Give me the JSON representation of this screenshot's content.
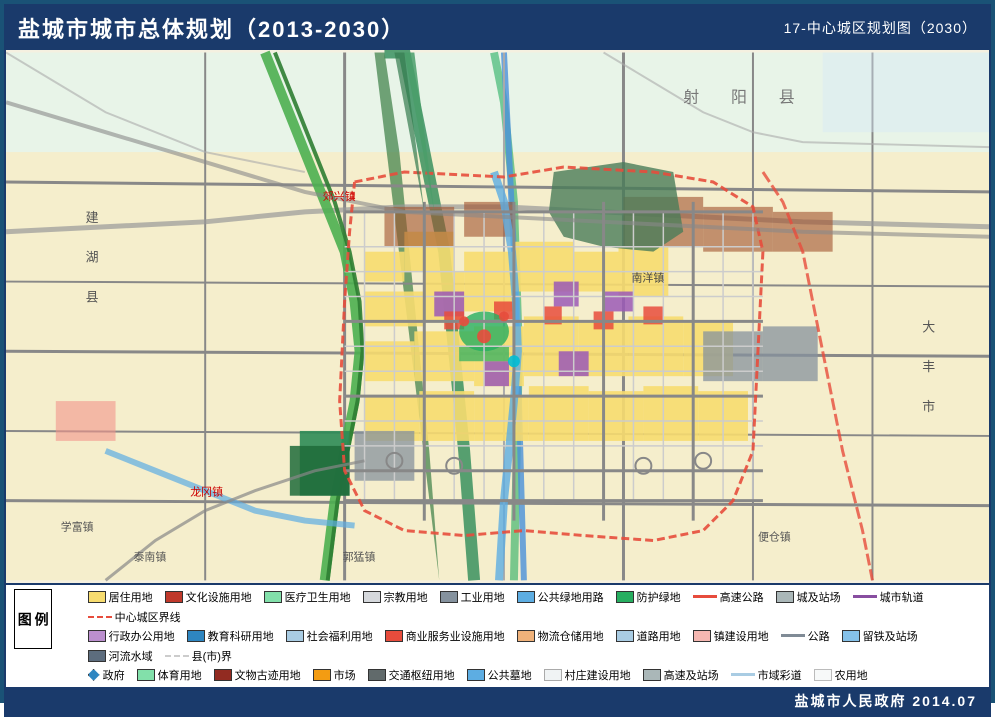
{
  "header": {
    "title": "盐城市城市总体规划（2013-2030）",
    "subtitle": "17-中心城区规划图（2030）"
  },
  "footer": {
    "text": "盐城市人民政府   2014.07"
  },
  "legend": {
    "title": "图\n例",
    "items_row1": [
      {
        "color": "#f7dc6f",
        "label": "居住用地"
      },
      {
        "color": "#d35400",
        "label": "文化设施用地"
      },
      {
        "color": "#82e0aa",
        "label": "医疗卫生用地"
      },
      {
        "color": "#d5d8dc",
        "label": "宗教用地"
      },
      {
        "color": "#808b96",
        "label": "工业用地"
      },
      {
        "color": "#5dade2",
        "label": "公共绿地用路"
      },
      {
        "color": "#27ae60",
        "label": "防护绿地"
      },
      {
        "color": "#e74c3c",
        "label": "高速公路"
      },
      {
        "color": "#aab7b8",
        "label": "城及站场"
      },
      {
        "color": "#884ea0",
        "label": "城市轨道"
      },
      {
        "color": "#e74c3c",
        "label": "中心城区界线",
        "dashed": true
      }
    ],
    "items_row2": [
      {
        "color": "#bb8fce",
        "label": "行政办公用地"
      },
      {
        "color": "#2e86c1",
        "label": "教育科研用地"
      },
      {
        "color": "#a9cce3",
        "label": "社会福利用地"
      },
      {
        "color": "#c0392b",
        "label": "商业服务业设施用地"
      },
      {
        "color": "#f0b27a",
        "label": "物流仓储用地"
      },
      {
        "color": "#a9cce3",
        "label": "道路用地"
      },
      {
        "color": "#f5b7b1",
        "label": "镇建设用地"
      },
      {
        "color": "#808b96",
        "label": "公路"
      },
      {
        "color": "#85c1e9",
        "label": "留铁及站场"
      },
      {
        "color": "#5d6d7e",
        "label": "河流水域"
      },
      {
        "color": "#ecf0f1",
        "label": "县(市)界"
      }
    ],
    "items_row3": [
      {
        "color": "#2e86c1",
        "label": "政府"
      },
      {
        "color": "#82e0aa",
        "label": "体育用地"
      },
      {
        "color": "#922b21",
        "label": "文物古迹用地"
      },
      {
        "color": "#f39c12",
        "label": "市场"
      },
      {
        "color": "#616a6b",
        "label": "交通枢纽用地"
      },
      {
        "color": "#5dade2",
        "label": "公共墓地"
      },
      {
        "color": "#f0f3f4",
        "label": "村庄建设用地"
      },
      {
        "color": "#aab7b8",
        "label": "高速及站场"
      },
      {
        "color": "#a9cce3",
        "label": "市域彩道"
      },
      {
        "color": "#f7f9f9",
        "label": "农用地"
      }
    ]
  }
}
